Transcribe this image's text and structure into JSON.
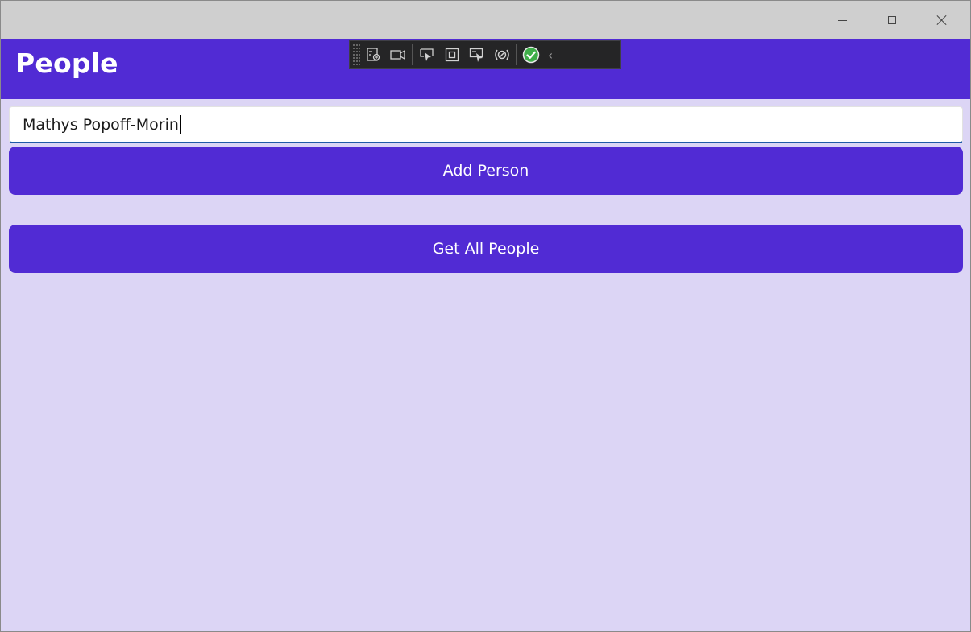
{
  "window": {
    "caption_buttons": [
      "minimize",
      "maximize",
      "close"
    ]
  },
  "navbar": {
    "title": "People"
  },
  "debug_toolbar": {
    "icons": [
      "live-visual-tree-icon",
      "record-icon",
      "select-element-icon",
      "display-layout-adorners-icon",
      "track-focus-icon",
      "hot-reload-icon",
      "binding-success-icon",
      "collapse-chevron-icon"
    ]
  },
  "form": {
    "name_value": "Mathys Popoff-Morin",
    "add_button_label": "Add Person",
    "get_all_button_label": "Get All People"
  },
  "colors": {
    "primary": "#512bd4",
    "background": "#dcd5f5",
    "titlebar": "#cfcfcf"
  }
}
